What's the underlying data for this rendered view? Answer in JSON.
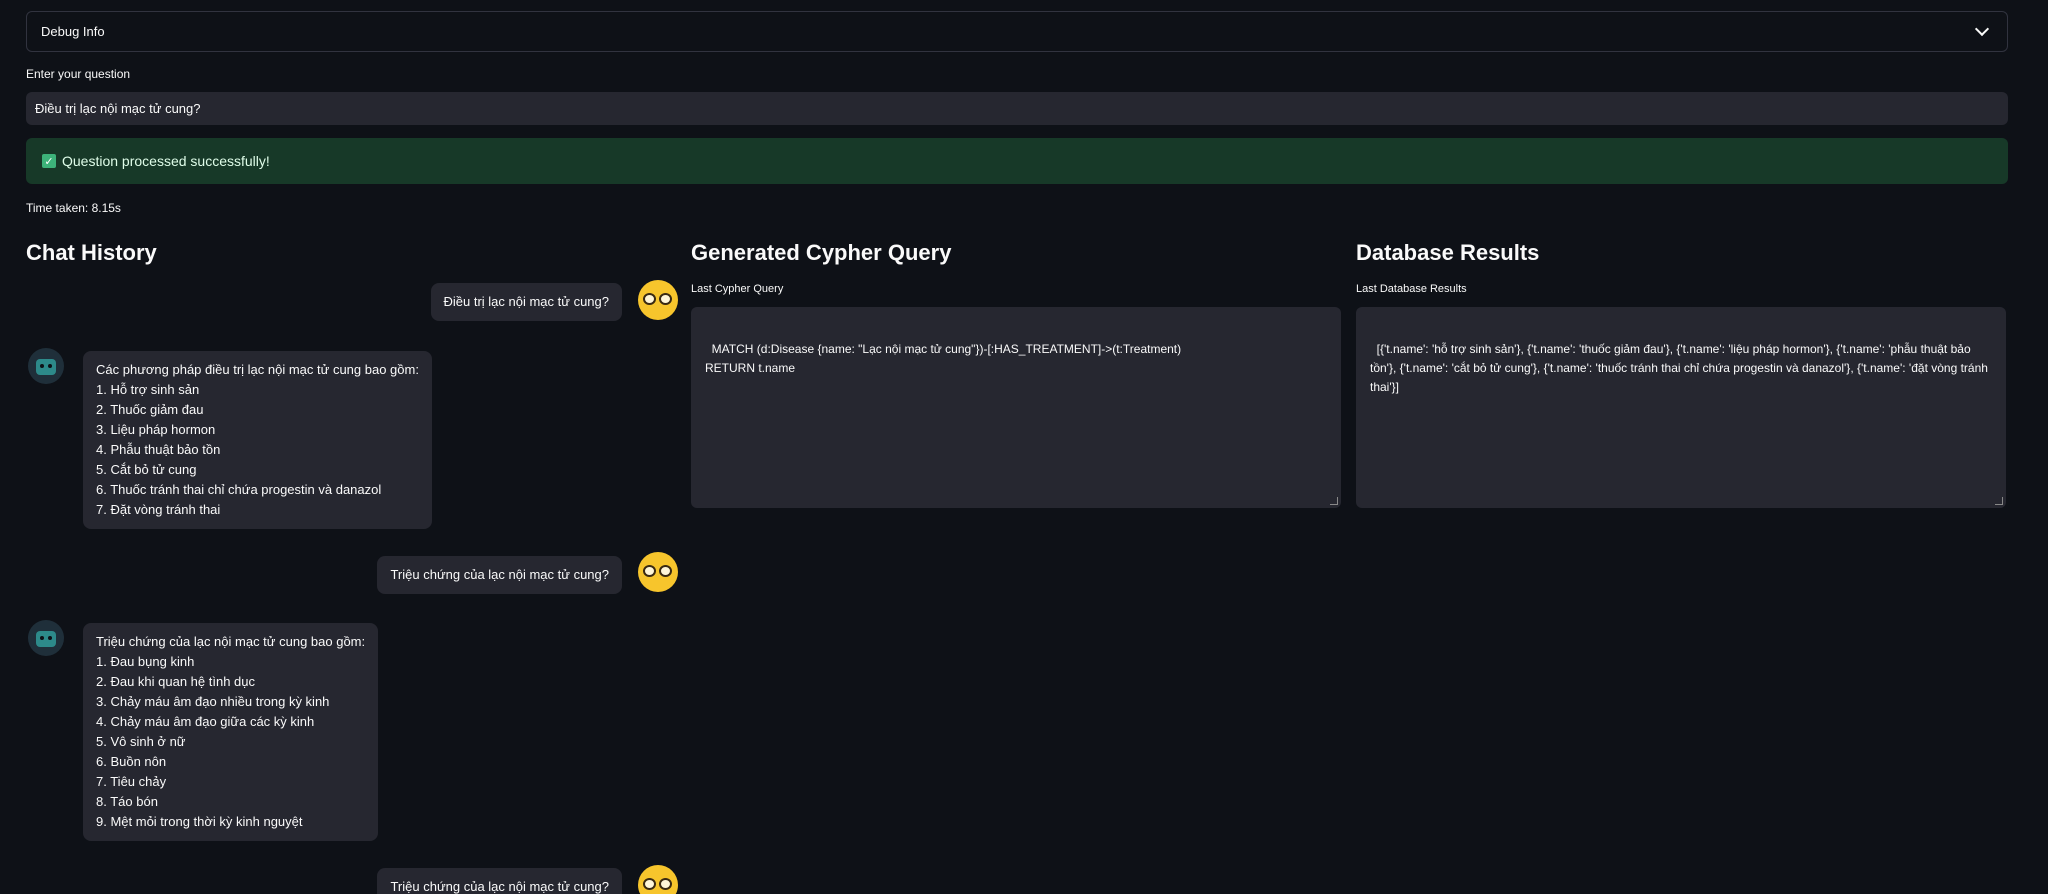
{
  "debug": {
    "label": "Debug Info"
  },
  "question": {
    "label": "Enter your question",
    "value": "Điều trị lạc nội mạc tử cung?"
  },
  "status": {
    "message": "Question processed successfully!",
    "time": "Time taken: 8.15s"
  },
  "chat": {
    "title": "Chat History",
    "messages": [
      {
        "role": "user",
        "text": "Điều trị lạc nội mạc tử cung?"
      },
      {
        "role": "bot",
        "lines": [
          "Các phương pháp điều trị lạc nội mạc tử cung bao gồm:",
          "1. Hỗ trợ sinh sản",
          "2. Thuốc giảm đau",
          "3. Liệu pháp hormon",
          "4. Phẫu thuật bảo tồn",
          "5. Cắt bỏ tử cung",
          "6. Thuốc tránh thai chỉ chứa progestin và danazol",
          "7. Đặt vòng tránh thai"
        ]
      },
      {
        "role": "user",
        "text": "Triệu chứng của lạc nội mạc tử cung?"
      },
      {
        "role": "bot",
        "lines": [
          "Triệu chứng của lạc nội mạc tử cung bao gồm:",
          "1. Đau bụng kinh",
          "2. Đau khi quan hệ tình dục",
          "3. Chảy máu âm đạo nhiều trong kỳ kinh",
          "4. Chảy máu âm đạo giữa các kỳ kinh",
          "5. Vô sinh ở nữ",
          "6. Buồn nôn",
          "7. Tiêu chảy",
          "8. Táo bón",
          "9. Mệt mỏi trong thời kỳ kinh nguyệt"
        ]
      },
      {
        "role": "user",
        "text": "Triệu chứng của lạc nội mạc tử cung?"
      }
    ]
  },
  "cypher": {
    "title": "Generated Cypher Query",
    "label": "Last Cypher Query",
    "query": "MATCH (d:Disease {name: \"Lạc nội mạc tử cung\"})-[:HAS_TREATMENT]->(t:Treatment)\nRETURN t.name"
  },
  "db": {
    "title": "Database Results",
    "label": "Last Database Results",
    "results": "[{'t.name': 'hỗ trợ sinh sản'}, {'t.name': 'thuốc giảm đau'}, {'t.name': 'liệu pháp hormon'}, {'t.name': 'phẫu thuật bảo tồn'}, {'t.name': 'cắt bỏ tử cung'}, {'t.name': 'thuốc tránh thai chỉ chứa progestin và danazol'}, {'t.name': 'đặt vòng tránh thai'}]"
  }
}
